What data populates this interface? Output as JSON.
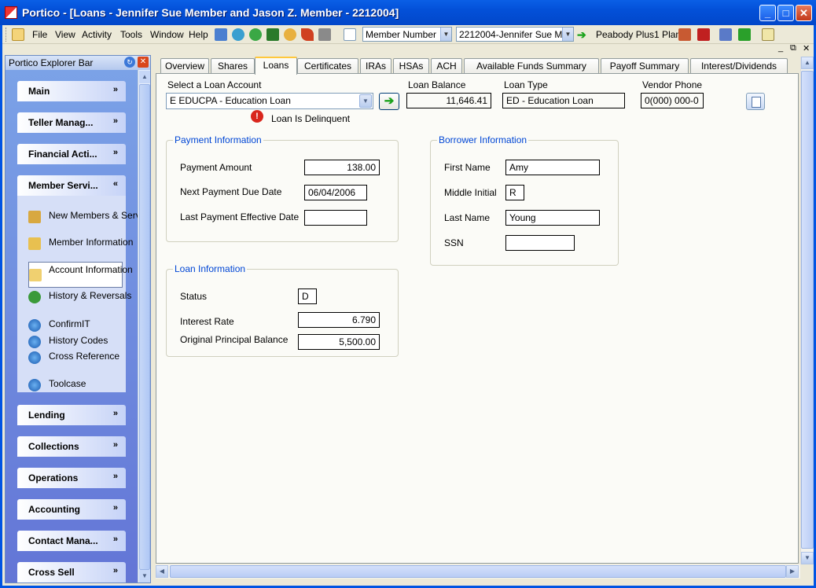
{
  "window": {
    "title": "Portico - [Loans - Jennifer Sue Member and Jason Z. Member - 2212004]",
    "min": "_",
    "max": "□",
    "close": "✕"
  },
  "menu": {
    "items": [
      "File",
      "View",
      "Activity",
      "Tools",
      "Window",
      "Help"
    ],
    "search_type": "Member Number",
    "member_select": "2212004-Jennifer Sue M",
    "plan": "Peabody Plus1 Plan",
    "sub_controls": [
      "_",
      "⧉",
      "✕"
    ]
  },
  "explorer": {
    "title": "Portico Explorer Bar",
    "groups_top": [
      {
        "label": "Main",
        "chev": "»"
      },
      {
        "label": "Teller Manag...",
        "chev": "»"
      },
      {
        "label": "Financial Acti...",
        "chev": "»"
      },
      {
        "label": "Member Servi...",
        "chev": "«"
      }
    ],
    "member_items": [
      "New Members & Services",
      "Member Information",
      "Account Information",
      "History & Reversals",
      "ConfirmIT",
      "History Codes",
      "Cross Reference",
      "Toolcase"
    ],
    "groups_bottom": [
      {
        "label": "Lending",
        "chev": "»"
      },
      {
        "label": "Collections",
        "chev": "»"
      },
      {
        "label": "Operations",
        "chev": "»"
      },
      {
        "label": "Accounting",
        "chev": "»"
      },
      {
        "label": "Contact Mana...",
        "chev": "»"
      },
      {
        "label": "Cross Sell",
        "chev": "»"
      }
    ]
  },
  "tabs": [
    "Overview",
    "Shares",
    "Loans",
    "Certificates",
    "IRAs",
    "HSAs",
    "ACH",
    "Available Funds Summary",
    "Payoff Summary",
    "Interest/Dividends"
  ],
  "loan": {
    "select_label": "Select a Loan Account",
    "selected_account": "E   EDUCPA - Education Loan",
    "balance_label": "Loan Balance",
    "balance": "11,646.41",
    "type_label": "Loan Type",
    "type": "ED - Education Loan",
    "vendor_label": "Vendor Phone",
    "vendor_phone": "0(000) 000-0",
    "delinquent_text": "Loan Is Delinquent",
    "warn_glyph": "!"
  },
  "payment": {
    "legend": "Payment Information",
    "amount_label": "Payment Amount",
    "amount": "138.00",
    "due_label": "Next Payment Due Date",
    "due": "06/04/2006",
    "last_label": "Last Payment Effective Date",
    "last": ""
  },
  "borrower": {
    "legend": "Borrower Information",
    "first_label": "First Name",
    "first": "Amy",
    "middle_label": "Middle Initial",
    "middle": "R",
    "last_label": "Last Name",
    "last": "Young",
    "ssn_label": "SSN",
    "ssn": ""
  },
  "loaninfo": {
    "legend": "Loan Information",
    "status_label": "Status",
    "status": "D",
    "rate_label": "Interest Rate",
    "rate": "6.790",
    "principal_label": "Original Principal Balance",
    "principal": "5,500.00"
  }
}
